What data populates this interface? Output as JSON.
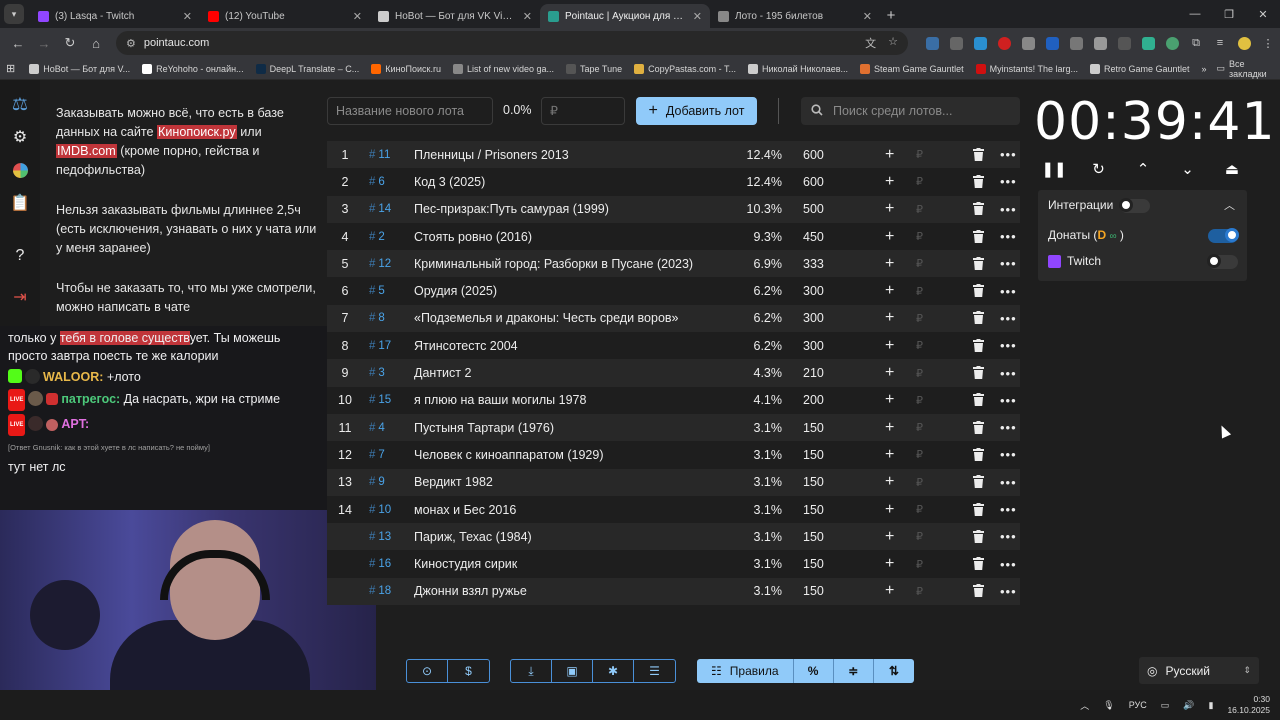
{
  "browser": {
    "tabs": [
      {
        "title": "(3) Lasqa - Twitch",
        "color": "#9146ff",
        "active": false
      },
      {
        "title": "(12) YouTube",
        "color": "#ff0000",
        "active": false
      },
      {
        "title": "HoBot — Бот для VK Video",
        "color": "#cccccc",
        "active": false
      },
      {
        "title": "Pointauc | Аукцион для стримеров",
        "color": "#2a9d8f",
        "active": true
      },
      {
        "title": "Лото - 195 билетов",
        "color": "#888888",
        "active": false
      }
    ],
    "url": "pointauc.com",
    "bookmarks": [
      {
        "label": "HoBot — Бот для V...",
        "color": "#cccccc"
      },
      {
        "label": "ReYohoho - онлайн...",
        "color": "#ffffff"
      },
      {
        "label": "DeepL Translate – С...",
        "color": "#0f2b46"
      },
      {
        "label": "КиноПоиск.ru",
        "color": "#ff6600"
      },
      {
        "label": "List of new video ga...",
        "color": "#888888"
      },
      {
        "label": "Tape Tune",
        "color": "#555555"
      },
      {
        "label": "CopyPastas.com - T...",
        "color": "#e0b040"
      },
      {
        "label": "Николай Николаев...",
        "color": "#cccccc"
      },
      {
        "label": "Steam Game Gauntlet",
        "color": "#e07030"
      },
      {
        "label": "Myinstants! The larg...",
        "color": "#d01010"
      },
      {
        "label": "Retro Game Gauntlet",
        "color": "#cccccc"
      }
    ],
    "all_bookmarks": "Все закладки"
  },
  "sidebar_text": {
    "p1_a": "Заказывать можно всё, что есть в базе данных на сайте ",
    "link1": "Кинопоиск.ру",
    "p1_b": " или ",
    "link2": "IMDB.com",
    "p1_c": " (кроме порно, гейства и педофильства)",
    "p2": "Нельзя заказывать фильмы длиннее 2,5ч (есть исключения, узнавать о них у чата или у меня заранее)",
    "p3": "Чтобы не заказать то, что мы уже смотрели, можно написать в чате"
  },
  "chat": {
    "line1_a": "только у ",
    "line1_hl": "тебя в голове существ",
    "line1_b": "ует. Ты можешь просто завтра поесть те же калории",
    "m2_user": "WALOOR:",
    "m2_text": " +лото",
    "m3_user": "патрегос:",
    "m3_text": " Да насрать, жри на стриме",
    "m4_user": "APT:",
    "reply": "[Ответ Gnusnik: как в этой хуете в лс написать? не пойму]",
    "m5_text": "тут нет лс"
  },
  "auction": {
    "lot_name_placeholder": "Название нового лота",
    "percent": "0.0%",
    "amount_placeholder": "₽",
    "add_label": "Добавить лот",
    "search_placeholder": "Поиск среди лотов...",
    "rub": "₽",
    "lots": [
      {
        "idx": "1",
        "id": "11",
        "name": "Пленницы / Prisoners 2013",
        "pct": "12.4%",
        "amount": "600"
      },
      {
        "idx": "2",
        "id": "6",
        "name": "Код 3 (2025)",
        "pct": "12.4%",
        "amount": "600"
      },
      {
        "idx": "3",
        "id": "14",
        "name": "Пес-призрак:Путь самурая (1999)",
        "pct": "10.3%",
        "amount": "500"
      },
      {
        "idx": "4",
        "id": "2",
        "name": "Стоять ровно (2016)",
        "pct": "9.3%",
        "amount": "450"
      },
      {
        "idx": "5",
        "id": "12",
        "name": "Криминальный город: Разборки в Пусане (2023)",
        "pct": "6.9%",
        "amount": "333"
      },
      {
        "idx": "6",
        "id": "5",
        "name": "Орудия (2025)",
        "pct": "6.2%",
        "amount": "300"
      },
      {
        "idx": "7",
        "id": "8",
        "name": "«Подземелья и драконы: Честь среди воров»",
        "pct": "6.2%",
        "amount": "300"
      },
      {
        "idx": "8",
        "id": "17",
        "name": "Ятинсотестс 2004",
        "pct": "6.2%",
        "amount": "300"
      },
      {
        "idx": "9",
        "id": "3",
        "name": "Дантист 2",
        "pct": "4.3%",
        "amount": "210"
      },
      {
        "idx": "10",
        "id": "15",
        "name": "я плюю на ваши могилы 1978",
        "pct": "4.1%",
        "amount": "200"
      },
      {
        "idx": "11",
        "id": "4",
        "name": "Пустыня Тартари (1976)",
        "pct": "3.1%",
        "amount": "150"
      },
      {
        "idx": "12",
        "id": "7",
        "name": "Человек с киноаппаратом (1929)",
        "pct": "3.1%",
        "amount": "150"
      },
      {
        "idx": "13",
        "id": "9",
        "name": "Вердикт 1982",
        "pct": "3.1%",
        "amount": "150"
      },
      {
        "idx": "14",
        "id": "10",
        "name": "монах и Бес  2016",
        "pct": "3.1%",
        "amount": "150"
      },
      {
        "idx": "",
        "id": "13",
        "name": "Париж, Техас (1984)",
        "pct": "3.1%",
        "amount": "150"
      },
      {
        "idx": "",
        "id": "16",
        "name": "Киностудия сирик",
        "pct": "3.1%",
        "amount": "150"
      },
      {
        "idx": "",
        "id": "18",
        "name": "Джонни взял ружье",
        "pct": "3.1%",
        "amount": "150"
      }
    ]
  },
  "timer": {
    "value": "00:39:41"
  },
  "integrations": {
    "title": "Интеграции",
    "donate_label": "Донаты (",
    "donate_close": " )",
    "twitch_label": "Twitch"
  },
  "bottom": {
    "rules_label": "Правила",
    "language": "Русский"
  },
  "taskbar": {
    "lang": "РУС",
    "time": "0:30",
    "date": "16.10.2025"
  }
}
